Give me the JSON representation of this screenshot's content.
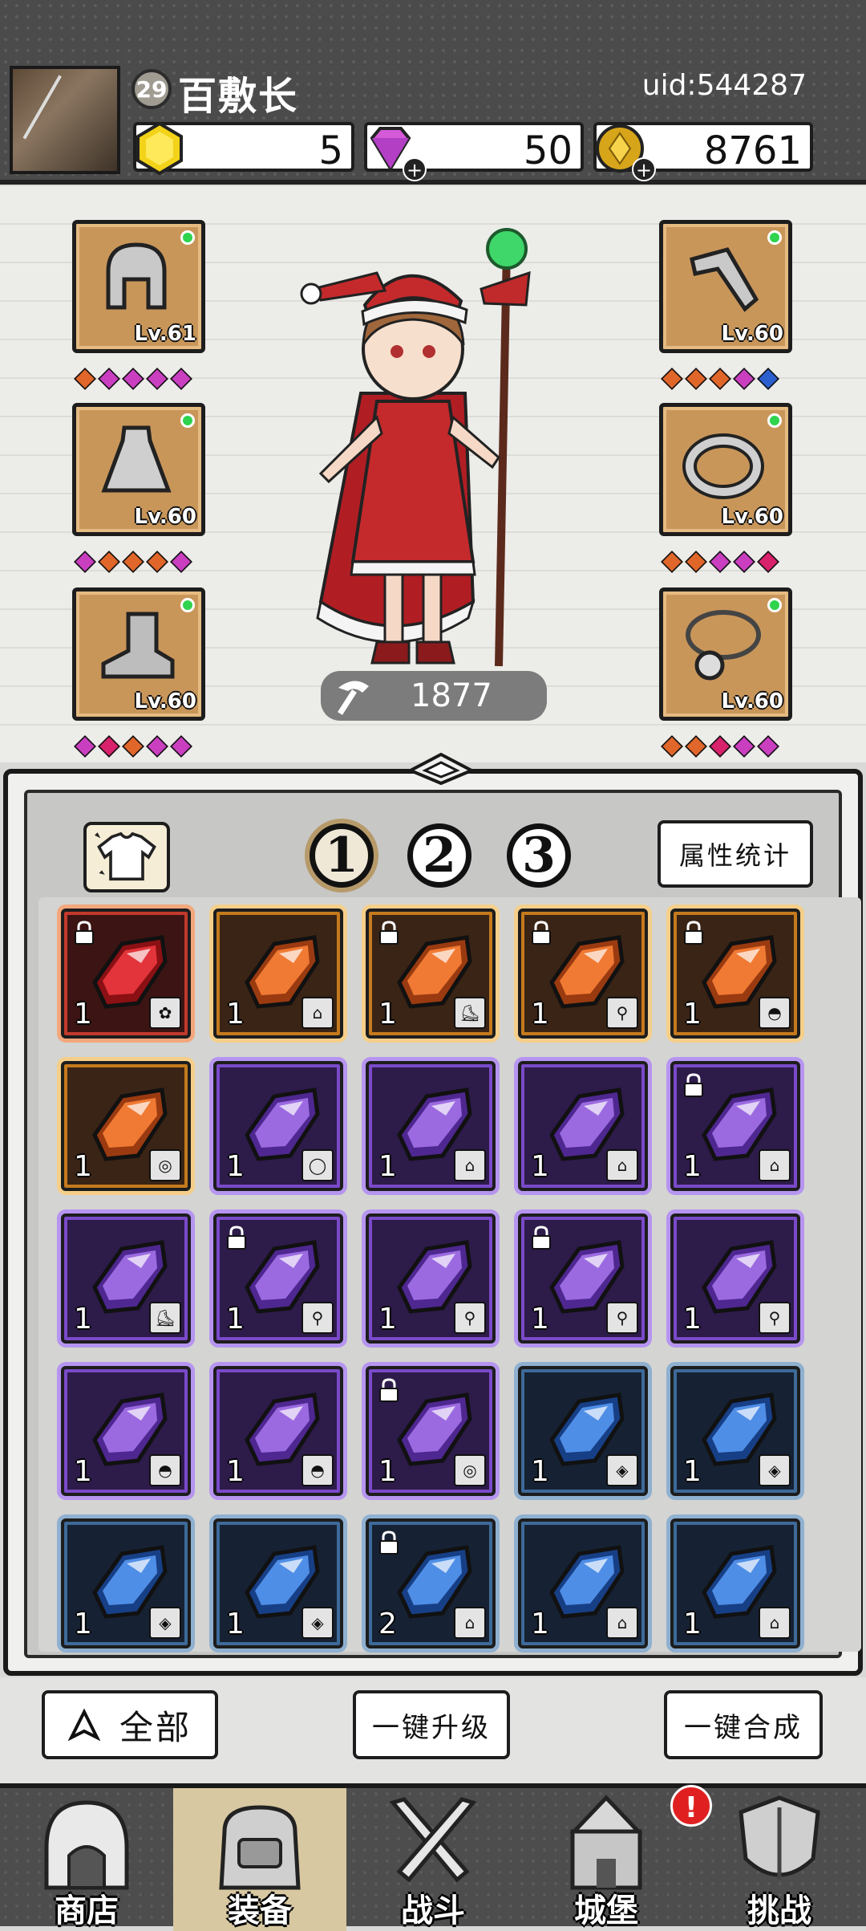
{
  "player": {
    "level": "29",
    "name": "百敷长",
    "uid": "uid:544287"
  },
  "resources": {
    "gold_gem": "5",
    "diamond": "50",
    "coin": "8761"
  },
  "equipment": {
    "left": [
      {
        "slot": "helmet",
        "level": "Lv.61",
        "gems": [
          "#e0662a",
          "#c93fc0",
          "#c93fc0",
          "#c93fc0",
          "#c93fc0"
        ]
      },
      {
        "slot": "cloak",
        "level": "Lv.60",
        "gems": [
          "#c93fc0",
          "#e0662a",
          "#e0662a",
          "#e0662a",
          "#c93fc0"
        ]
      },
      {
        "slot": "boots",
        "level": "Lv.60",
        "gems": [
          "#c93fc0",
          "#d8226b",
          "#e0662a",
          "#c93fc0",
          "#c93fc0"
        ]
      }
    ],
    "right": [
      {
        "slot": "weapon",
        "level": "Lv.60",
        "gems": [
          "#e0662a",
          "#e0662a",
          "#e0662a",
          "#c93fc0",
          "#2b5fcf"
        ]
      },
      {
        "slot": "ring",
        "level": "Lv.60",
        "gems": [
          "#e0662a",
          "#e0662a",
          "#c93fc0",
          "#c93fc0",
          "#d8226b"
        ]
      },
      {
        "slot": "necklace",
        "level": "Lv.60",
        "gems": [
          "#e0662a",
          "#e0662a",
          "#d8226b",
          "#c93fc0",
          "#c93fc0"
        ]
      }
    ]
  },
  "power": "1877",
  "tabs": {
    "one": "1",
    "two": "2",
    "three": "3",
    "stats_label": "属性统计"
  },
  "inventory": [
    {
      "color": "red",
      "qty": "1",
      "locked": true,
      "tag": "cape"
    },
    {
      "color": "orange",
      "qty": "1",
      "locked": false,
      "tag": "cloak"
    },
    {
      "color": "orange",
      "qty": "1",
      "locked": true,
      "tag": "boot"
    },
    {
      "color": "orange",
      "qty": "1",
      "locked": true,
      "tag": "weapon"
    },
    {
      "color": "orange",
      "qty": "1",
      "locked": true,
      "tag": "helmet"
    },
    {
      "color": "orange",
      "qty": "1",
      "locked": false,
      "tag": "necklace"
    },
    {
      "color": "purple",
      "qty": "1",
      "locked": false,
      "tag": "ring"
    },
    {
      "color": "purple",
      "qty": "1",
      "locked": false,
      "tag": "cloak"
    },
    {
      "color": "purple",
      "qty": "1",
      "locked": false,
      "tag": "cloak"
    },
    {
      "color": "purple",
      "qty": "1",
      "locked": true,
      "tag": "cloak"
    },
    {
      "color": "purple",
      "qty": "1",
      "locked": false,
      "tag": "boot"
    },
    {
      "color": "purple",
      "qty": "1",
      "locked": true,
      "tag": "weapon"
    },
    {
      "color": "purple",
      "qty": "1",
      "locked": false,
      "tag": "weapon"
    },
    {
      "color": "purple",
      "qty": "1",
      "locked": true,
      "tag": "weapon"
    },
    {
      "color": "purple",
      "qty": "1",
      "locked": false,
      "tag": "weapon"
    },
    {
      "color": "purple",
      "qty": "1",
      "locked": false,
      "tag": "helmet"
    },
    {
      "color": "purple",
      "qty": "1",
      "locked": false,
      "tag": "helmet"
    },
    {
      "color": "purple",
      "qty": "1",
      "locked": true,
      "tag": "necklace"
    },
    {
      "color": "blue",
      "qty": "1",
      "locked": false,
      "tag": "drop"
    },
    {
      "color": "blue",
      "qty": "1",
      "locked": false,
      "tag": "drop"
    },
    {
      "color": "blue",
      "qty": "1",
      "locked": false,
      "tag": "drop"
    },
    {
      "color": "blue",
      "qty": "1",
      "locked": false,
      "tag": "drop"
    },
    {
      "color": "blue",
      "qty": "2",
      "locked": true,
      "tag": "cloak"
    },
    {
      "color": "blue",
      "qty": "1",
      "locked": false,
      "tag": "cloak"
    },
    {
      "color": "blue",
      "qty": "1",
      "locked": false,
      "tag": "cloak"
    }
  ],
  "actions": {
    "all": "全部",
    "upgrade": "一键升级",
    "merge": "一键合成"
  },
  "nav": {
    "shop": "商店",
    "equip": "装备",
    "battle": "战斗",
    "castle": "城堡",
    "challenge": "挑战",
    "alert": "!"
  },
  "colors": {
    "red": "#c13a2c",
    "orange": "#c57a1d",
    "purple": "#7a4ac9",
    "blue": "#3d6a99",
    "frame": "#c9965a"
  }
}
